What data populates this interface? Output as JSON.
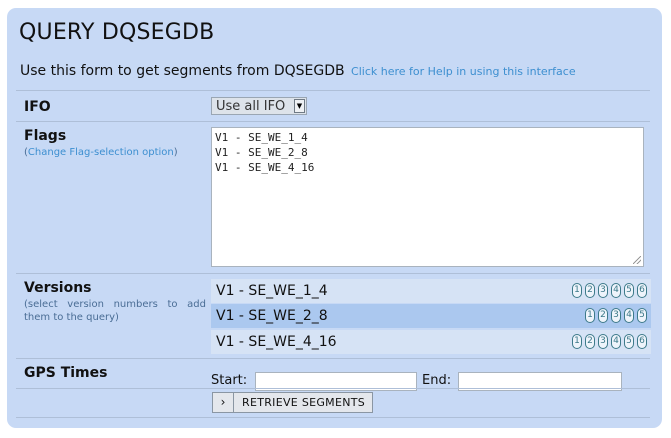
{
  "header": {
    "title": "QUERY DQSEGDB",
    "intro": "Use this form to get segments from DQSEGDB",
    "help_link": "Click here for Help in using this interface"
  },
  "ifo": {
    "label": "IFO",
    "selected": "Use all IFO"
  },
  "flags": {
    "label": "Flags",
    "sub_open": "(",
    "sub_link": "Change Flag-selection option",
    "sub_close": ")",
    "lines": [
      "V1 - SE_WE_1_4",
      "V1 - SE_WE_2_8",
      "V1 - SE_WE_4_16"
    ]
  },
  "versions": {
    "label": "Versions",
    "sub": "(select version numbers to add them to the query)",
    "rows": [
      {
        "name": "V1 - SE_WE_1_4",
        "nums": [
          "1",
          "2",
          "3",
          "4",
          "5",
          "6"
        ]
      },
      {
        "name": "V1 - SE_WE_2_8",
        "nums": [
          "1",
          "2",
          "3",
          "4",
          "5"
        ]
      },
      {
        "name": "V1 - SE_WE_4_16",
        "nums": [
          "1",
          "2",
          "3",
          "4",
          "5",
          "6"
        ]
      }
    ]
  },
  "gps": {
    "label": "GPS Times",
    "start_label": "Start:",
    "end_label": "End:",
    "start_value": "",
    "end_value": ""
  },
  "submit": {
    "chevron": "›",
    "label": "RETRIEVE SEGMENTS"
  }
}
